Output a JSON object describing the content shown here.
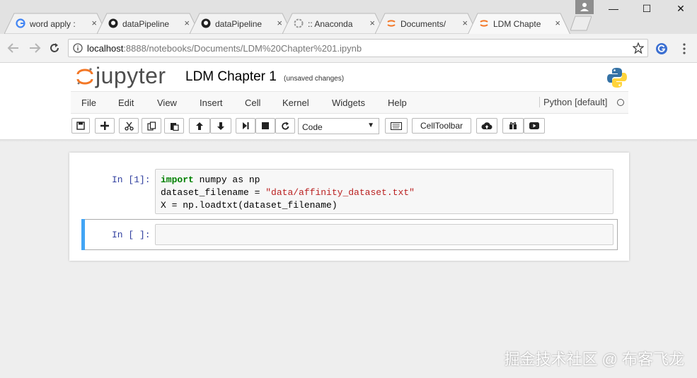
{
  "browser": {
    "tabs": [
      {
        "label": "word apply :",
        "icon": "google-icon"
      },
      {
        "label": "dataPipeline",
        "icon": "github-icon"
      },
      {
        "label": "dataPipeline",
        "icon": "github-icon"
      },
      {
        "label": ":: Anaconda",
        "icon": "anaconda-icon"
      },
      {
        "label": "Documents/",
        "icon": "jupyter-icon"
      },
      {
        "label": "LDM Chapte",
        "icon": "jupyter-icon"
      }
    ],
    "tab_close_glyph": "×",
    "url_host": "localhost",
    "url_rest": ":8888/notebooks/Documents/LDM%20Chapter%201.ipynb",
    "window_controls": {
      "minimize": "—",
      "maximize": "☐",
      "close": "✕"
    }
  },
  "notebook": {
    "logo_text": "jupyter",
    "title": "LDM Chapter 1",
    "save_status": "(unsaved changes)",
    "menu": [
      "File",
      "Edit",
      "View",
      "Insert",
      "Cell",
      "Kernel",
      "Widgets",
      "Help"
    ],
    "kernel": "Python [default]",
    "toolbar": {
      "cell_type": "Code",
      "celltoolbar_label": "CellToolbar"
    },
    "cells": [
      {
        "prompt": "In [1]:",
        "lines": [
          {
            "kw": "import",
            "rest": " numpy as np"
          },
          {
            "text": "dataset_filename = ",
            "str": "\"data/affinity_dataset.txt\""
          },
          {
            "text": "X = np.loadtxt(dataset_filename)"
          }
        ]
      },
      {
        "prompt": "In [ ]:",
        "lines": []
      }
    ]
  },
  "watermark": "掘金技术社区 @ 布客飞龙",
  "colors": {
    "accent": "#42a5f5",
    "prompt": "#303f9f",
    "jupyter_orange": "#f37726"
  }
}
